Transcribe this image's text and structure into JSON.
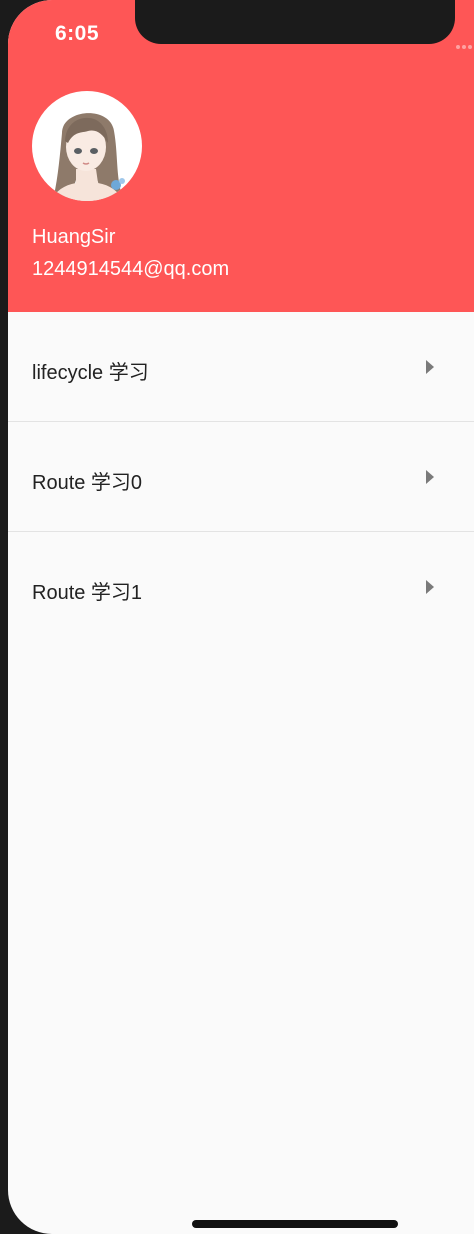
{
  "status_bar": {
    "time": "6:05"
  },
  "drawer_header": {
    "avatar_icon": "user-avatar-portrait",
    "user_name": "HuangSir",
    "user_email": "1244914544@qq.com",
    "background_color": "#fe5656"
  },
  "menu": {
    "items": [
      {
        "label": "lifecycle 学习",
        "icon": "chevron-right-icon"
      },
      {
        "label": "Route 学习0",
        "icon": "chevron-right-icon"
      },
      {
        "label": "Route 学习1",
        "icon": "chevron-right-icon"
      }
    ]
  }
}
